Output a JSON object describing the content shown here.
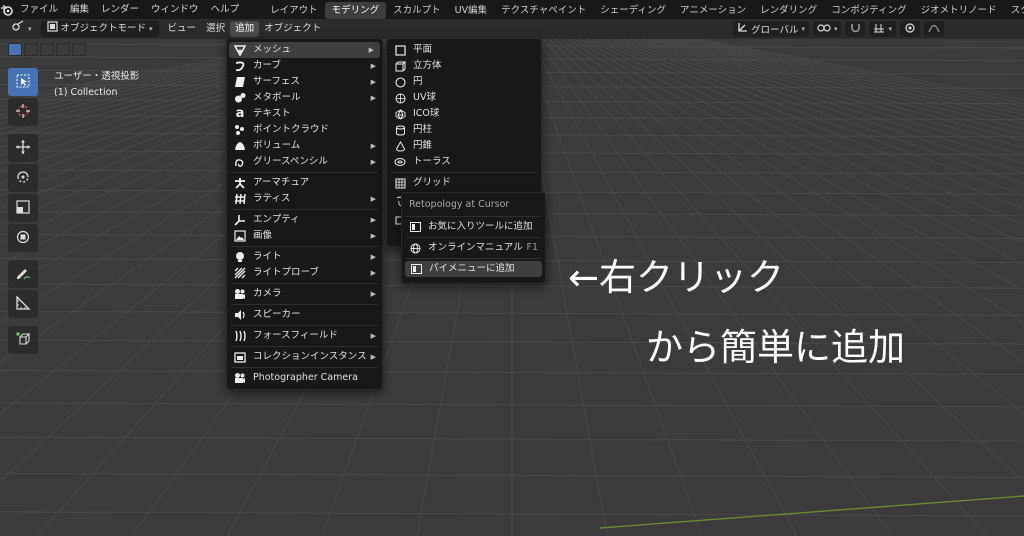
{
  "topbar": {
    "menus": [
      "ファイル",
      "編集",
      "レンダー",
      "ウィンドウ",
      "ヘルプ"
    ],
    "workspaces": [
      "レイアウト",
      "モデリング",
      "スカルプト",
      "UV編集",
      "テクスチャペイント",
      "シェーディング",
      "アニメーション",
      "レンダリング",
      "コンポジティング",
      "ジオメトリノード",
      "スクリプト"
    ],
    "active_workspace": "モデリング"
  },
  "header": {
    "mode": "オブジェクトモード",
    "menus": [
      "ビュー",
      "選択",
      "追加",
      "オブジェクト"
    ],
    "active_menu": "追加",
    "transform_orientation": "グローバル"
  },
  "viewport": {
    "view_name": "ユーザー・透視投影",
    "collection": "(1) Collection",
    "colors": {
      "background": "#3b3b3b",
      "grid": "#4a4a4a",
      "x_axis": "#8a3a3a",
      "y_axis": "#6e8a2e"
    }
  },
  "add_menu": {
    "items": [
      {
        "label": "メッシュ",
        "icon": "mesh-icon",
        "submenu": true
      },
      {
        "label": "カーブ",
        "icon": "curve-icon",
        "submenu": true
      },
      {
        "label": "サーフェス",
        "icon": "surface-icon",
        "submenu": true
      },
      {
        "label": "メタボール",
        "icon": "metaball-icon",
        "submenu": true
      },
      {
        "label": "テキスト",
        "icon": "text-icon",
        "submenu": false
      },
      {
        "label": "ポイントクラウド",
        "icon": "pointcloud-icon",
        "submenu": false
      },
      {
        "label": "ボリューム",
        "icon": "volume-icon",
        "submenu": true
      },
      {
        "label": "グリースペンシル",
        "icon": "greasepencil-icon",
        "submenu": true
      },
      {
        "label": "アーマチュア",
        "icon": "armature-icon",
        "submenu": false
      },
      {
        "label": "ラティス",
        "icon": "lattice-icon",
        "submenu": true
      },
      {
        "label": "エンプティ",
        "icon": "empty-icon",
        "submenu": true
      },
      {
        "label": "画像",
        "icon": "image-icon",
        "submenu": true
      },
      {
        "label": "ライト",
        "icon": "light-icon",
        "submenu": true
      },
      {
        "label": "ライトプローブ",
        "icon": "lightprobe-icon",
        "submenu": true
      },
      {
        "label": "カメラ",
        "icon": "camera-icon",
        "submenu": true
      },
      {
        "label": "スピーカー",
        "icon": "speaker-icon",
        "submenu": false
      },
      {
        "label": "フォースフィールド",
        "icon": "forcefield-icon",
        "submenu": true
      },
      {
        "label": "コレクションインスタンス",
        "icon": "collection-instance-icon",
        "submenu": true
      },
      {
        "label": "Photographer Camera",
        "icon": "camera-icon",
        "submenu": false
      }
    ]
  },
  "mesh_menu": {
    "items": [
      {
        "label": "平面",
        "icon": "plane-icon"
      },
      {
        "label": "立方体",
        "icon": "cube-icon"
      },
      {
        "label": "円",
        "icon": "circle-icon"
      },
      {
        "label": "UV球",
        "icon": "uvsphere-icon"
      },
      {
        "label": "ICO球",
        "icon": "icosphere-icon"
      },
      {
        "label": "円柱",
        "icon": "cylinder-icon"
      },
      {
        "label": "円錐",
        "icon": "cone-icon"
      },
      {
        "label": "トーラス",
        "icon": "torus-icon"
      },
      {
        "label": "グリッド",
        "icon": "grid-icon"
      }
    ]
  },
  "context_menu": {
    "title": "Retopology at Cursor",
    "items": [
      {
        "label": "お気に入りツールに追加",
        "shortcut": ""
      },
      {
        "label": "オンラインマニュアル",
        "shortcut": "F1"
      },
      {
        "label": "パイメニューに追加",
        "shortcut": ""
      }
    ]
  },
  "annotation": {
    "line1": "←右クリック",
    "line2": "から簡単に追加"
  }
}
